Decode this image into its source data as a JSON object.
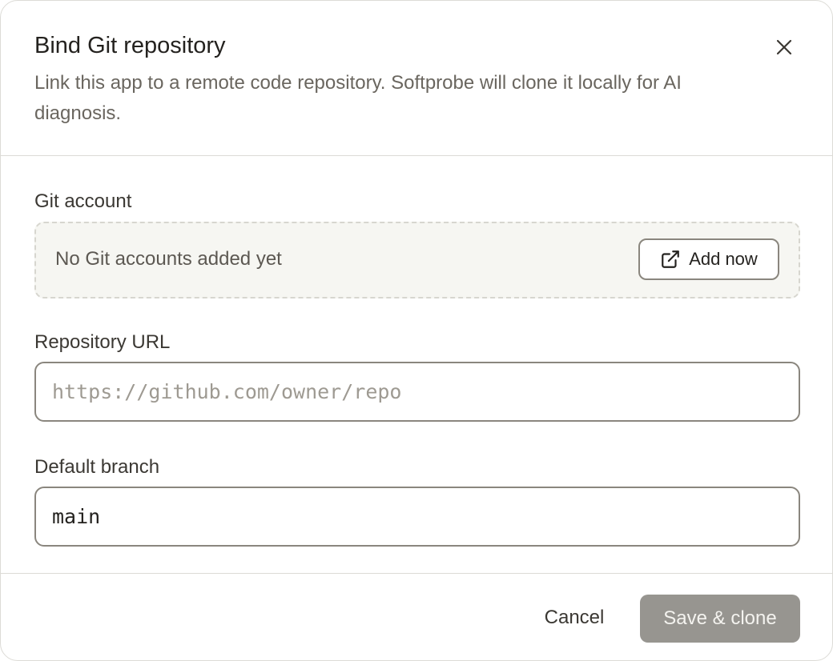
{
  "dialog": {
    "title": "Bind Git repository",
    "subtitle": "Link this app to a remote code repository. Softprobe will clone it locally for AI diagnosis."
  },
  "icons": {
    "close": "close-icon",
    "external_link": "external-link-icon"
  },
  "git_account": {
    "label": "Git account",
    "empty_text": "No Git accounts added yet",
    "add_button_label": "Add now"
  },
  "repository_url": {
    "label": "Repository URL",
    "placeholder": "https://github.com/owner/repo",
    "value": ""
  },
  "default_branch": {
    "label": "Default branch",
    "value": "main"
  },
  "footer": {
    "cancel_label": "Cancel",
    "save_label": "Save & clone"
  },
  "colors": {
    "primary_disabled": "#979590",
    "border": "#8a867e",
    "empty_box_bg": "#f6f6f2"
  }
}
